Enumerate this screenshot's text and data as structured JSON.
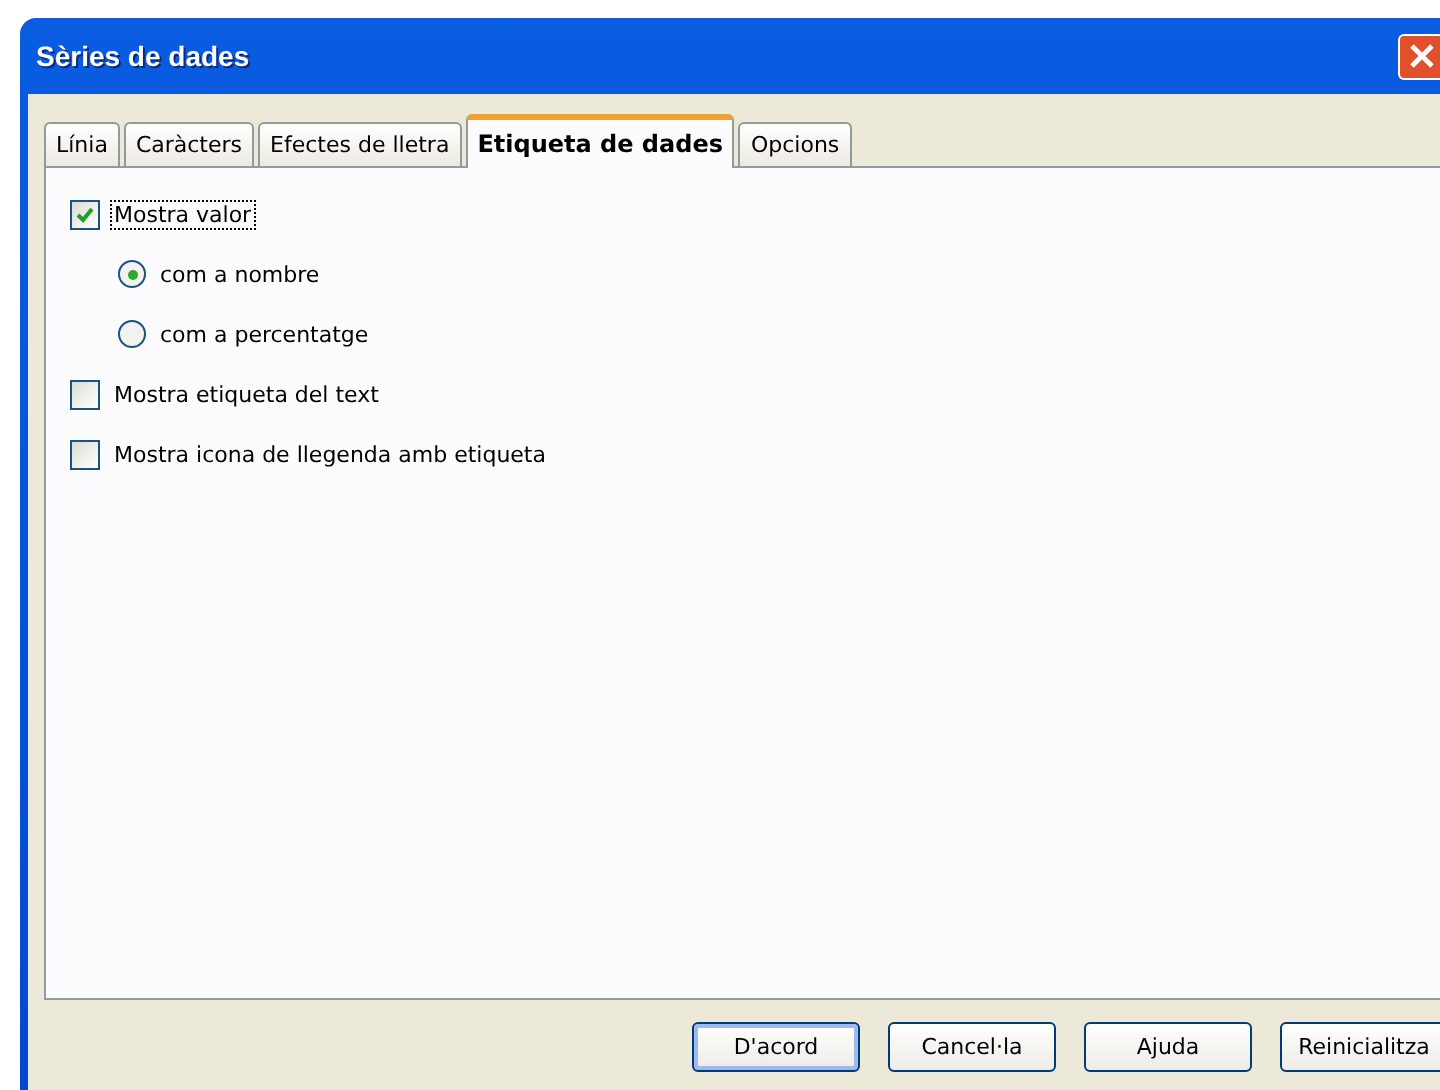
{
  "window": {
    "title": "Sèries de dades"
  },
  "tabs": [
    {
      "label": "Línia",
      "selected": false
    },
    {
      "label": "Caràcters",
      "selected": false
    },
    {
      "label": "Efectes de lletra",
      "selected": false
    },
    {
      "label": "Etiqueta de dades",
      "selected": true
    },
    {
      "label": "Opcions",
      "selected": false
    }
  ],
  "options": [
    {
      "kind": "checkbox",
      "label": "Mostra valor",
      "checked": true,
      "focused": true,
      "children": [
        {
          "kind": "radio",
          "label": "com a nombre",
          "selected": true
        },
        {
          "kind": "radio",
          "label": "com a percentatge",
          "selected": false
        }
      ]
    },
    {
      "kind": "checkbox",
      "label": "Mostra etiqueta del text",
      "checked": false,
      "focused": false
    },
    {
      "kind": "checkbox",
      "label": "Mostra icona de llegenda amb etiqueta",
      "checked": false,
      "focused": false
    }
  ],
  "buttons": [
    {
      "label": "D'acord",
      "default": true
    },
    {
      "label": "Cancel·la",
      "default": false
    },
    {
      "label": "Ajuda",
      "default": false
    },
    {
      "label": "Reinicialitza",
      "default": false
    }
  ]
}
